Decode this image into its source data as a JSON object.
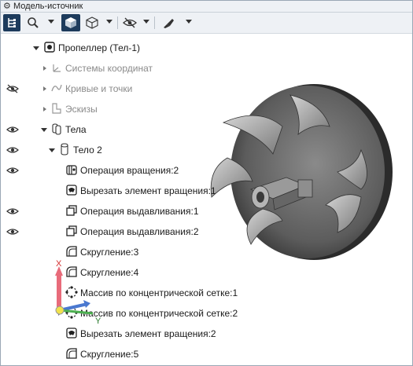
{
  "window": {
    "title": "Модель-источник"
  },
  "toolbar": {
    "buttons": [
      "tree-view",
      "search",
      "solid-view",
      "wireframe-view",
      "visibility",
      "style"
    ]
  },
  "tree": {
    "root": "Пропеллер (Тел-1)",
    "items": [
      {
        "label": "Системы координат",
        "dim": true
      },
      {
        "label": "Кривые и точки",
        "dim": true
      },
      {
        "label": "Эскизы",
        "dim": true
      },
      {
        "label": "Тела"
      },
      {
        "label": "Тело 2"
      },
      {
        "label": "Операция вращения:2"
      },
      {
        "label": "Вырезать элемент вращения:1"
      },
      {
        "label": "Операция выдавливания:1"
      },
      {
        "label": "Операция выдавливания:2"
      },
      {
        "label": "Скругление:3"
      },
      {
        "label": "Скругление:4"
      },
      {
        "label": "Массив по концентрической сетке:1"
      },
      {
        "label": "Массив по концентрической сетке:2"
      },
      {
        "label": "Вырезать элемент вращения:2"
      },
      {
        "label": "Скругление:5"
      }
    ]
  },
  "axes": {
    "x": "X",
    "y": "Y"
  },
  "colors": {
    "accent": "#1d3b5c",
    "tree_text": "#1a1a1a",
    "dim_text": "#8a8a8a"
  }
}
